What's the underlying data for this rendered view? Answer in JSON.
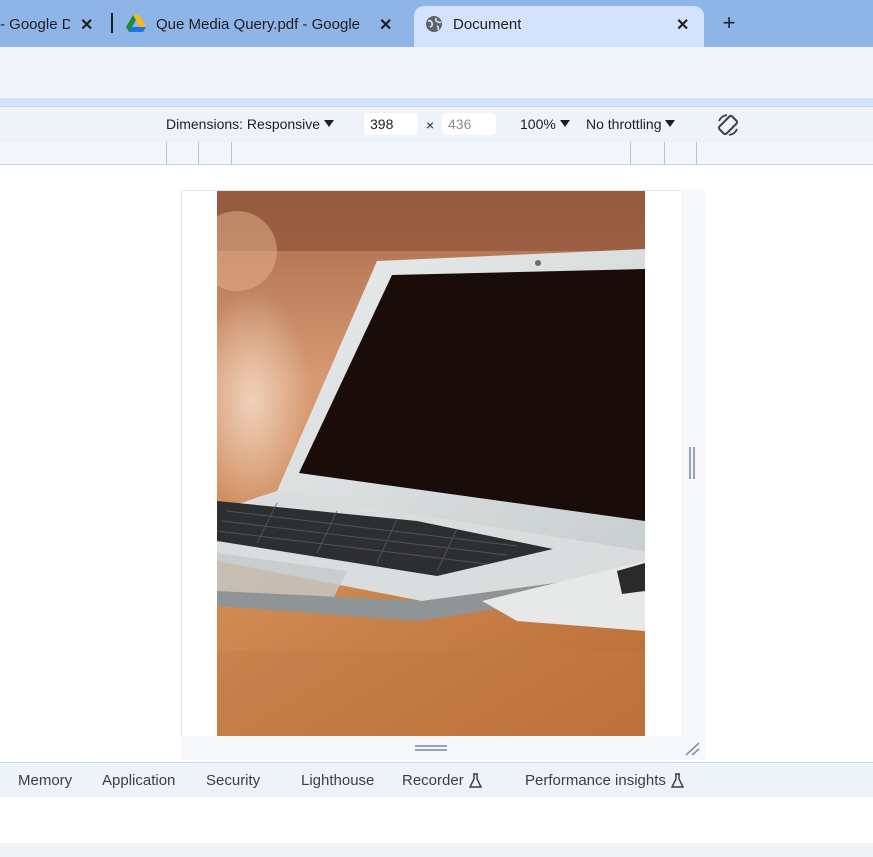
{
  "browser": {
    "tabs": [
      {
        "title": "- Google D",
        "favicon": "none"
      },
      {
        "title": "Que Media Query.pdf - Google",
        "favicon": "google-drive-icon"
      },
      {
        "title": "Document",
        "favicon": "globe-icon",
        "active": true
      }
    ],
    "close_glyph": "✕",
    "new_tab_glyph": "+"
  },
  "device_toolbar": {
    "dimensions_label": "Dimensions: Responsive",
    "width_value": "398",
    "height_placeholder": "436",
    "times_glyph": "×",
    "zoom_label": "100%",
    "throttling_label": "No throttling",
    "rotate_icon": "rotate-icon"
  },
  "viewport": {
    "image_alt": "Laptop on a wooden desk"
  },
  "devtools": {
    "tabs": [
      {
        "label": "Memory"
      },
      {
        "label": "Application"
      },
      {
        "label": "Security"
      },
      {
        "label": "Lighthouse"
      },
      {
        "label": "Recorder",
        "experimental": true
      },
      {
        "label": "Performance insights",
        "experimental": true
      }
    ],
    "experimental_icon": "flask-icon"
  },
  "colors": {
    "tabstrip": "#8fb4e8",
    "active_tab": "#d3e3fd",
    "toolbar": "#eef2f9"
  }
}
